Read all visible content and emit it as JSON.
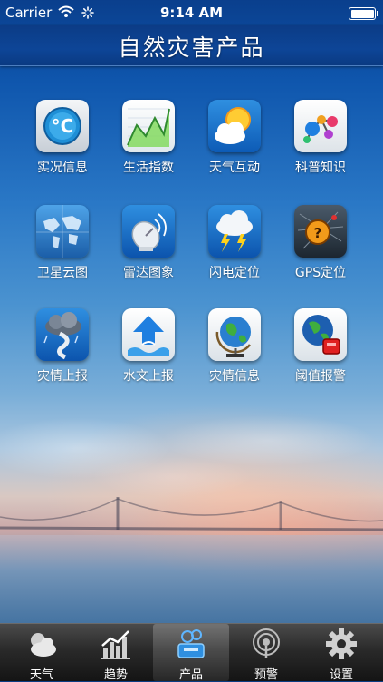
{
  "status_bar": {
    "carrier": "Carrier",
    "time": "9:14 AM"
  },
  "header": {
    "title": "自然灾害产品"
  },
  "grid": {
    "items": [
      {
        "label": "实况信息",
        "icon": "celsius-icon"
      },
      {
        "label": "生活指数",
        "icon": "line-chart-icon"
      },
      {
        "label": "天气互动",
        "icon": "sun-cloud-icon"
      },
      {
        "label": "科普知识",
        "icon": "molecule-icon"
      },
      {
        "label": "卫星云图",
        "icon": "world-map-icon"
      },
      {
        "label": "雷达图象",
        "icon": "radar-dish-icon"
      },
      {
        "label": "闪电定位",
        "icon": "lightning-cloud-icon"
      },
      {
        "label": "GPS定位",
        "icon": "gps-map-icon"
      },
      {
        "label": "灾情上报",
        "icon": "storm-report-icon"
      },
      {
        "label": "水文上报",
        "icon": "hydrology-icon"
      },
      {
        "label": "灾情信息",
        "icon": "globe-icon"
      },
      {
        "label": "阈值报警",
        "icon": "alarm-globe-icon"
      }
    ]
  },
  "tab_bar": {
    "tabs": [
      {
        "label": "天气",
        "icon": "weather-icon"
      },
      {
        "label": "趋势",
        "icon": "trend-chart-icon"
      },
      {
        "label": "产品",
        "icon": "products-icon",
        "active": true
      },
      {
        "label": "预警",
        "icon": "warning-signal-icon"
      },
      {
        "label": "设置",
        "icon": "gear-icon"
      }
    ]
  }
}
